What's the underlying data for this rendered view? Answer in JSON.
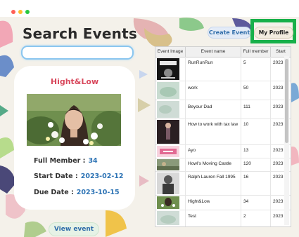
{
  "page": {
    "title": "Search Events",
    "search_placeholder": ""
  },
  "header": {
    "create_event": "Create Event",
    "my_profile": "My Profile"
  },
  "card": {
    "event_name": "Hight&Low",
    "full_member_label": "Full Member :",
    "full_member_value": "34",
    "start_date_label": "Start Date :",
    "start_date_value": "2023-02-12",
    "due_date_label": "Due Date :",
    "due_date_value": "2023-10-15",
    "view_button": "View event"
  },
  "table": {
    "columns": [
      "Event Image",
      "Event name",
      "Full member",
      "Start"
    ],
    "rows": [
      {
        "name": "RunRunRun",
        "members": "5",
        "start": "2023",
        "thumb": "run-logo"
      },
      {
        "name": "work",
        "members": "50",
        "start": "2023",
        "thumb": "light-photo"
      },
      {
        "name": "Beyour Dad",
        "members": "111",
        "start": "2023",
        "thumb": "light-photo"
      },
      {
        "name": "How to work with tax law",
        "members": "10",
        "start": "2023",
        "thumb": "dark-photo"
      },
      {
        "name": "Ayo",
        "members": "13",
        "start": "2023",
        "thumb": "pink-banner"
      },
      {
        "name": "Howl's Moving Castle",
        "members": "120",
        "start": "2023",
        "thumb": "scene-photo"
      },
      {
        "name": "Ralph Lauren Fall 1995",
        "members": "16",
        "start": "2023",
        "thumb": "gray-photo"
      },
      {
        "name": "Hight&Low",
        "members": "34",
        "start": "2023",
        "thumb": "green-photo"
      },
      {
        "name": "Test",
        "members": "2",
        "start": "2023",
        "thumb": "light-photo"
      }
    ]
  },
  "colors": {
    "accent_blue": "#2e74b5",
    "title_red": "#d8485c",
    "highlight_green": "#17b04a"
  }
}
